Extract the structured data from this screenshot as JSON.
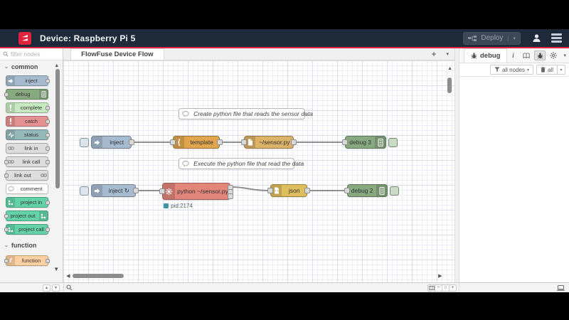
{
  "header": {
    "title": "Device: Raspberry Pi 5",
    "deploy_label": "Deploy"
  },
  "workspace": {
    "flow_tab": "FlowFuse Device Flow"
  },
  "palette": {
    "search_placeholder": "filter nodes",
    "categories": [
      {
        "label": "common",
        "nodes": [
          {
            "label": "inject",
            "color": "#a6bbcf"
          },
          {
            "label": "debug",
            "color": "#87a980"
          },
          {
            "label": "complete",
            "color": "#c7e9c0"
          },
          {
            "label": "catch",
            "color": "#e49191"
          },
          {
            "label": "status",
            "color": "#94b8b8"
          },
          {
            "label": "link in",
            "color": "#dddddd"
          },
          {
            "label": "link call",
            "color": "#dddddd"
          },
          {
            "label": "link out",
            "color": "#dddddd"
          },
          {
            "label": "comment",
            "color": "#ffffff"
          },
          {
            "label": "project in",
            "color": "#63d2a8"
          },
          {
            "label": "project out",
            "color": "#63d2a8"
          },
          {
            "label": "project call",
            "color": "#63d2a8"
          }
        ]
      },
      {
        "label": "function",
        "nodes": [
          {
            "label": "function",
            "color": "#fdd0a2"
          }
        ]
      }
    ]
  },
  "canvas": {
    "comments": [
      {
        "label": "Create python file that reads the sensor data"
      },
      {
        "label": "Execute the python file that read the data"
      }
    ],
    "nodes": {
      "inject1": {
        "label": "inject",
        "color": "#a6bbcf"
      },
      "template": {
        "label": "template",
        "color": "#e1a64d"
      },
      "file": {
        "label": "~/sensor.py",
        "color": "#dbb267"
      },
      "debug3": {
        "label": "debug 3",
        "color": "#87a980"
      },
      "inject2": {
        "label": "inject ↻",
        "color": "#a6bbcf"
      },
      "exec": {
        "label": "python ~/sensor.py",
        "color": "#e2857a"
      },
      "json": {
        "label": "json",
        "color": "#debd5c"
      },
      "debug2": {
        "label": "debug 2",
        "color": "#87a980"
      }
    },
    "status": {
      "text": "pid:2174",
      "color": "#3d95a5"
    }
  },
  "sidebar": {
    "tab_label": "debug",
    "filter_nodes_label": "all nodes",
    "clear_label": "all"
  },
  "glyphs": {
    "plus": "+",
    "caret_down": "▾",
    "chevron_down": "⌄",
    "scroll_up": "▲",
    "scroll_down": "▼",
    "scroll_left": "◀",
    "scroll_right": "▶",
    "mini_up": "▲",
    "mini_down": "▼",
    "zoom_out": "−",
    "zoom_reset": "○",
    "zoom_in": "+",
    "info": "i"
  },
  "colors": {
    "brand_red": "#e0243e",
    "header_bg": "#1e2a3a",
    "wire": "#8f8f8f"
  }
}
